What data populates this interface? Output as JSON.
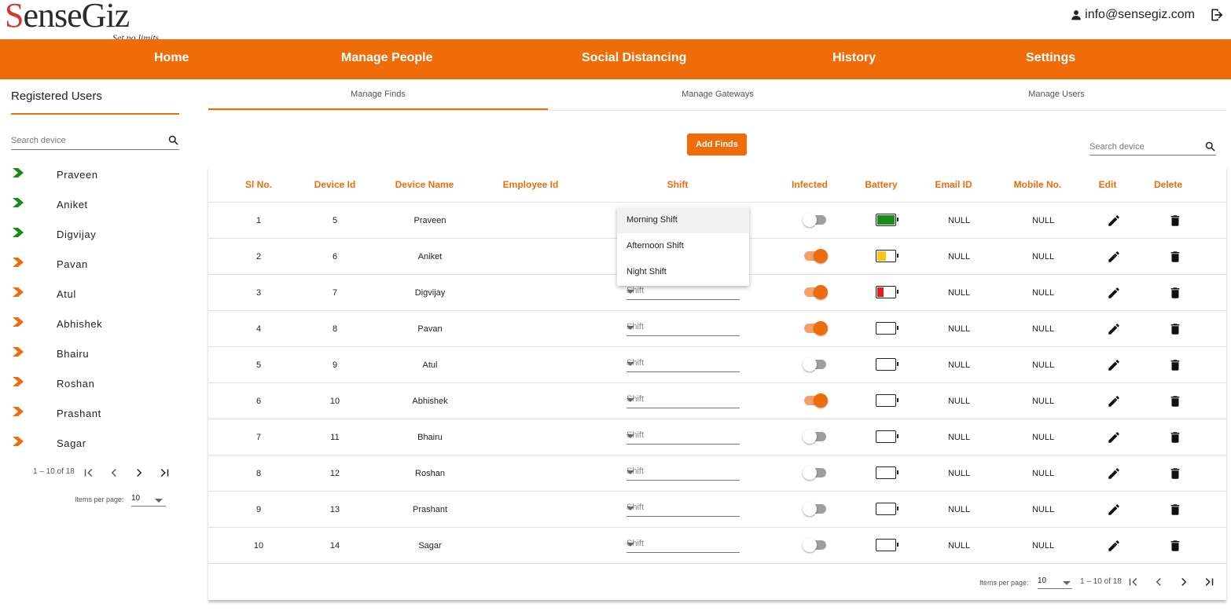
{
  "header": {
    "brand": "SenseGiz",
    "tagline": "Set no limits",
    "user_email": "info@sensegiz.com"
  },
  "nav": [
    "Home",
    "Manage People",
    "Social Distancing",
    "History",
    "Settings"
  ],
  "sidebar": {
    "title": "Registered Users",
    "search_placeholder": "Search device",
    "users": [
      {
        "name": "Praveen",
        "status_color": "#1a8a1a"
      },
      {
        "name": "Aniket",
        "status_color": "#1a8a1a"
      },
      {
        "name": "Digvijay",
        "status_color": "#1a8a1a"
      },
      {
        "name": "Pavan",
        "status_color": "#ee6c0a"
      },
      {
        "name": "Atul",
        "status_color": "#ee6c0a"
      },
      {
        "name": "Abhishek",
        "status_color": "#ee6c0a"
      },
      {
        "name": "Bhairu",
        "status_color": "#ee6c0a"
      },
      {
        "name": "Roshan",
        "status_color": "#ee6c0a"
      },
      {
        "name": "Prashant",
        "status_color": "#ee6c0a"
      },
      {
        "name": "Sagar",
        "status_color": "#ee6c0a"
      }
    ],
    "range_label": "1 – 10 of 18",
    "items_per_page_label": "Items per page:",
    "items_per_page": "10"
  },
  "tabs": [
    "Manage Finds",
    "Manage Gateways",
    "Manage Users"
  ],
  "toolbar": {
    "add_label": "Add Finds",
    "search_placeholder": "Search device"
  },
  "table": {
    "headers": [
      "Sl No.",
      "Device Id",
      "Device Name",
      "Employee Id",
      "Shift",
      "Infected",
      "Battery",
      "Email ID",
      "Mobile No.",
      "Edit",
      "Delete"
    ],
    "rows": [
      {
        "sl": "1",
        "device_id": "5",
        "name": "Praveen",
        "shift": "Shift",
        "infected": false,
        "battery_level": 1.0,
        "battery_color": "#1a8a1a",
        "email": "NULL",
        "mobile": "NULL"
      },
      {
        "sl": "2",
        "device_id": "6",
        "name": "Aniket",
        "shift": "Shift",
        "infected": true,
        "battery_level": 0.5,
        "battery_color": "#f5c518",
        "email": "NULL",
        "mobile": "NULL"
      },
      {
        "sl": "3",
        "device_id": "7",
        "name": "Digvijay",
        "shift": "Shift",
        "infected": true,
        "battery_level": 0.35,
        "battery_color": "#e02020",
        "email": "NULL",
        "mobile": "NULL"
      },
      {
        "sl": "4",
        "device_id": "8",
        "name": "Pavan",
        "shift": "Shift",
        "infected": true,
        "battery_level": 0,
        "battery_color": "#ffffff",
        "email": "NULL",
        "mobile": "NULL"
      },
      {
        "sl": "5",
        "device_id": "9",
        "name": "Atul",
        "shift": "Shift",
        "infected": false,
        "battery_level": 0,
        "battery_color": "#ffffff",
        "email": "NULL",
        "mobile": "NULL"
      },
      {
        "sl": "6",
        "device_id": "10",
        "name": "Abhishek",
        "shift": "Shift",
        "infected": true,
        "battery_level": 0,
        "battery_color": "#ffffff",
        "email": "NULL",
        "mobile": "NULL"
      },
      {
        "sl": "7",
        "device_id": "11",
        "name": "Bhairu",
        "shift": "Shift",
        "infected": false,
        "battery_level": 0,
        "battery_color": "#ffffff",
        "email": "NULL",
        "mobile": "NULL"
      },
      {
        "sl": "8",
        "device_id": "12",
        "name": "Roshan",
        "shift": "Shift",
        "infected": false,
        "battery_level": 0,
        "battery_color": "#ffffff",
        "email": "NULL",
        "mobile": "NULL"
      },
      {
        "sl": "9",
        "device_id": "13",
        "name": "Prashant",
        "shift": "Shift",
        "infected": false,
        "battery_level": 0,
        "battery_color": "#ffffff",
        "email": "NULL",
        "mobile": "NULL"
      },
      {
        "sl": "10",
        "device_id": "14",
        "name": "Sagar",
        "shift": "Shift",
        "infected": false,
        "battery_level": 0,
        "battery_color": "#ffffff",
        "email": "NULL",
        "mobile": "NULL"
      }
    ]
  },
  "shift_dropdown": {
    "options": [
      "Morning Shift",
      "Afternoon Shift",
      "Night Shift"
    ],
    "highlighted": "Morning Shift"
  },
  "footer": {
    "items_per_page_label": "Items per page:",
    "items_per_page": "10",
    "range_label": "1 – 10 of 18"
  },
  "colors": {
    "accent": "#ee6c0a",
    "online": "#1a8a1a"
  }
}
